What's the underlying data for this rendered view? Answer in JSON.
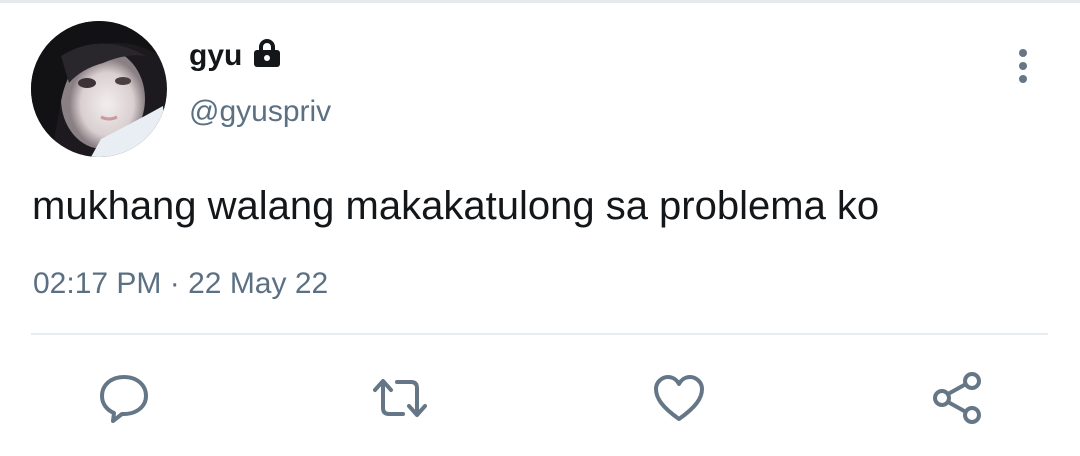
{
  "tweet": {
    "display_name": "gyu",
    "username": "@gyuspriv",
    "text": "mukhang walang makakatulong sa problema ko",
    "time": "02:17 PM",
    "separator": "·",
    "date": "22 May 22",
    "locked": true
  },
  "icons": {
    "lock": "lock-icon",
    "more": "more-vertical-icon",
    "reply": "reply-icon",
    "retweet": "retweet-icon",
    "like": "heart-icon",
    "share": "share-icon"
  },
  "colors": {
    "text_primary": "#14171a",
    "text_secondary": "#5b7083",
    "icon": "#657786",
    "divider": "#e6ecf0"
  }
}
